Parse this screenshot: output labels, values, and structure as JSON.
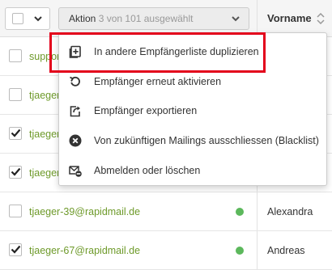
{
  "header": {
    "action_label": "Aktion",
    "selection_text": "3 von 101 ausgewählt",
    "column_title": "Vorname"
  },
  "menu": {
    "items": [
      {
        "label": "In andere Empfängerliste duplizieren",
        "icon": "duplicate-icon"
      },
      {
        "label": "Empfänger erneut aktivieren",
        "icon": "reactivate-icon"
      },
      {
        "label": "Empfänger exportieren",
        "icon": "export-icon"
      },
      {
        "label": "Von zukünftigen Mailings ausschliessen (Blacklist)",
        "icon": "blacklist-icon"
      },
      {
        "label": "Abmelden oder löschen",
        "icon": "unsubscribe-icon"
      }
    ]
  },
  "rows": [
    {
      "email": "support",
      "checked": false,
      "name": ""
    },
    {
      "email": "tjaeger",
      "checked": false,
      "name": ""
    },
    {
      "email": "tjaeger",
      "checked": true,
      "name": ""
    },
    {
      "email": "tjaeger",
      "checked": true,
      "name": ""
    },
    {
      "email": "tjaeger-39@rapidmail.de",
      "checked": false,
      "name": "Alexandra",
      "status": "active"
    },
    {
      "email": "tjaeger-67@rapidmail.de",
      "checked": true,
      "name": "Andreas",
      "status": "active"
    }
  ],
  "colors": {
    "email_link": "#6e9a2a",
    "status_active": "#5cb85c",
    "highlight": "#e3001b"
  }
}
